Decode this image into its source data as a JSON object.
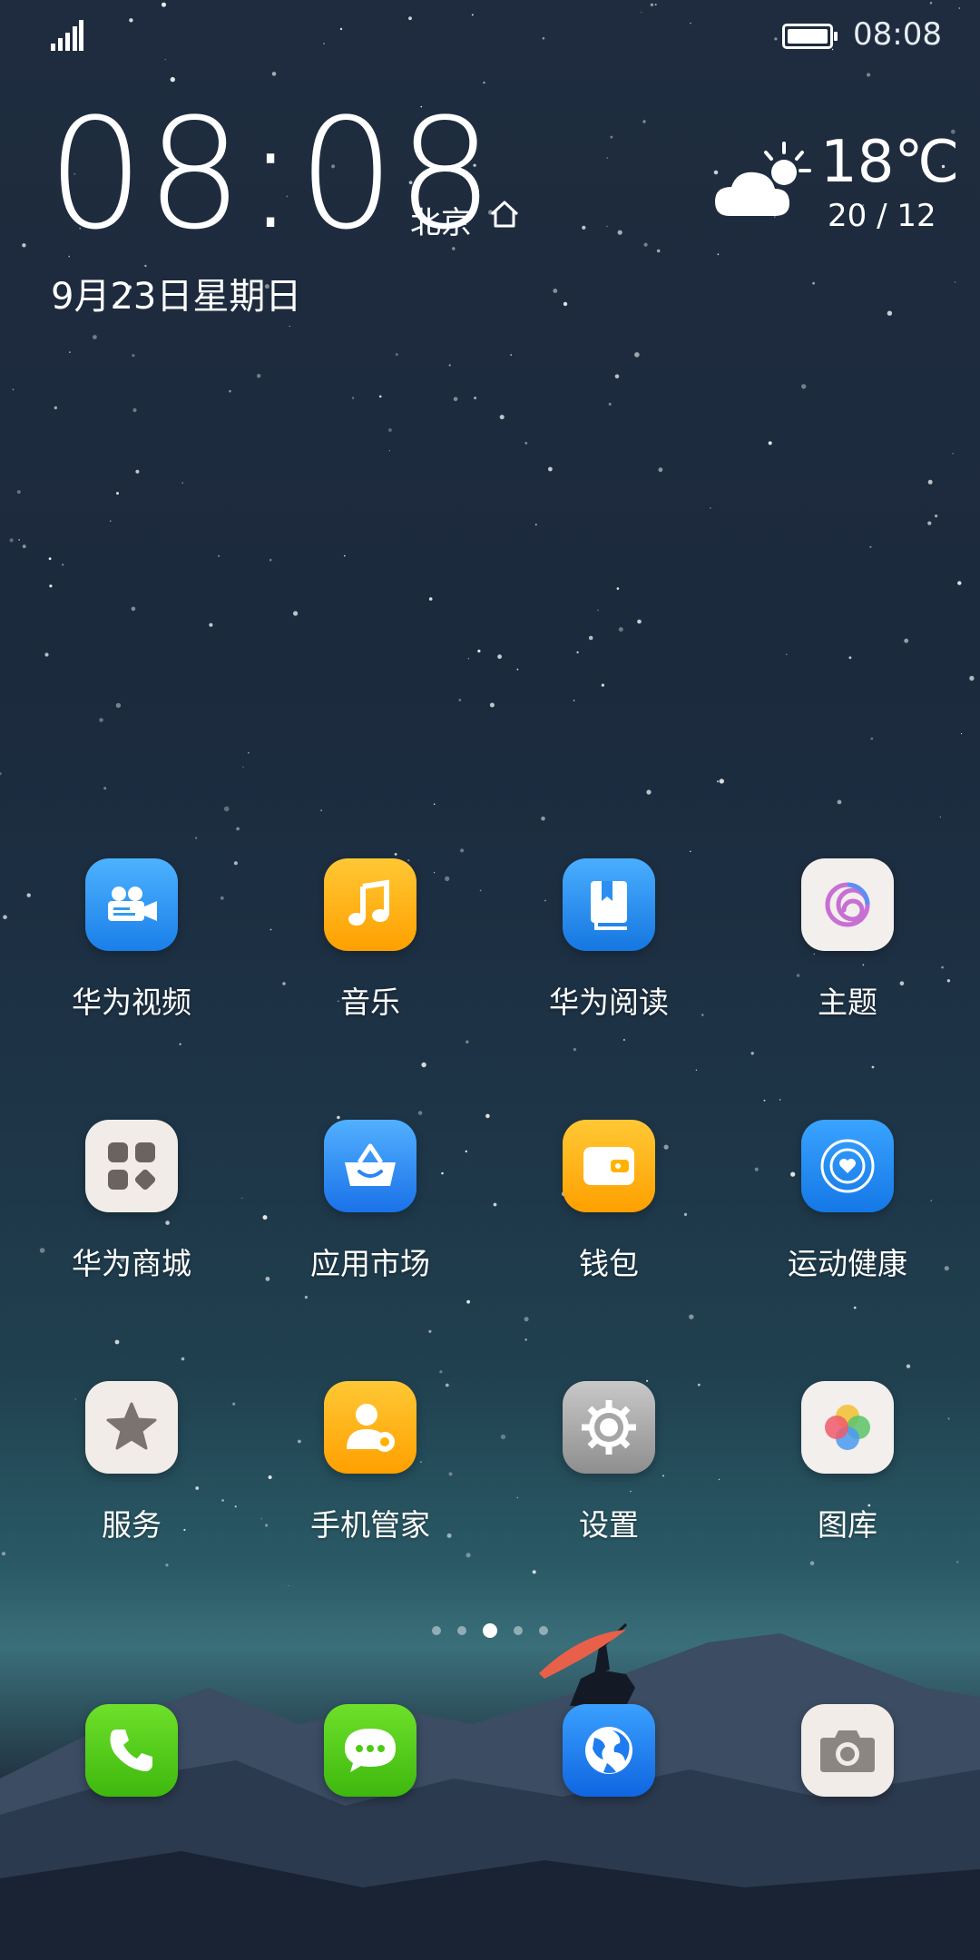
{
  "status_bar": {
    "time": "08:08"
  },
  "clock": {
    "time": "08:08",
    "city": "北京",
    "date": "9月23日星期日"
  },
  "weather": {
    "temperature": "18℃",
    "range": "20 / 12"
  },
  "apps": [
    {
      "label": "华为视频",
      "icon": "video-camera-icon",
      "color": "#2f9cf0"
    },
    {
      "label": "音乐",
      "icon": "music-note-icon",
      "color": "#ffb300"
    },
    {
      "label": "华为阅读",
      "icon": "book-icon",
      "color": "#1e8ff0"
    },
    {
      "label": "主题",
      "icon": "theme-swirl-icon",
      "color": "#f4f2f0"
    },
    {
      "label": "华为商城",
      "icon": "store-grid-icon",
      "color": "#f4f2f0"
    },
    {
      "label": "应用市场",
      "icon": "basket-icon",
      "color": "#2f8af0"
    },
    {
      "label": "钱包",
      "icon": "wallet-icon",
      "color": "#ffb300"
    },
    {
      "label": "运动健康",
      "icon": "heart-ring-icon",
      "color": "#1e8ff0"
    },
    {
      "label": "服务",
      "icon": "star-icon",
      "color": "#f4f2f0"
    },
    {
      "label": "手机管家",
      "icon": "user-gear-icon",
      "color": "#ffb300"
    },
    {
      "label": "设置",
      "icon": "gear-icon",
      "color": "#b0b0b0"
    },
    {
      "label": "图库",
      "icon": "petals-icon",
      "color": "#f4f2f0"
    }
  ],
  "page_indicator": {
    "count": 5,
    "active": 3
  },
  "dock": [
    {
      "icon": "phone-icon",
      "color": "#4ccb14"
    },
    {
      "icon": "message-icon",
      "color": "#4ccb14"
    },
    {
      "icon": "browser-globe-icon",
      "color": "#1e7cf0"
    },
    {
      "icon": "camera-icon",
      "color": "#f4f2f0"
    }
  ]
}
